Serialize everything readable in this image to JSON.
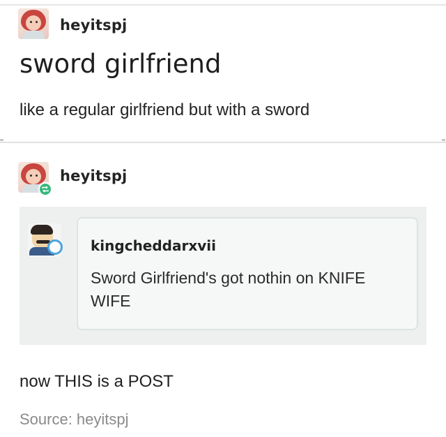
{
  "op_post": {
    "username": "heyitspj",
    "avatar_icon": "girl-with-red-hair-avatar-icon",
    "title": "sword girlfriend",
    "body": "like a regular girlfriend but with a sword"
  },
  "reblog": {
    "username": "heyitspj",
    "avatar_icon": "girl-with-red-hair-avatar-icon",
    "badge_icon": "reblog-icon",
    "badge_color": "#35b87a",
    "quoted": {
      "username": "kingcheddarxvii",
      "avatar_icon": "cartoon-man-avatar-icon",
      "badge_color": "#4aa5e0",
      "text": "Sword Girlfriend's got nothin on KNIFE WIFE"
    },
    "comment": "now THIS is a POST",
    "source": "Source: heyitspj"
  }
}
